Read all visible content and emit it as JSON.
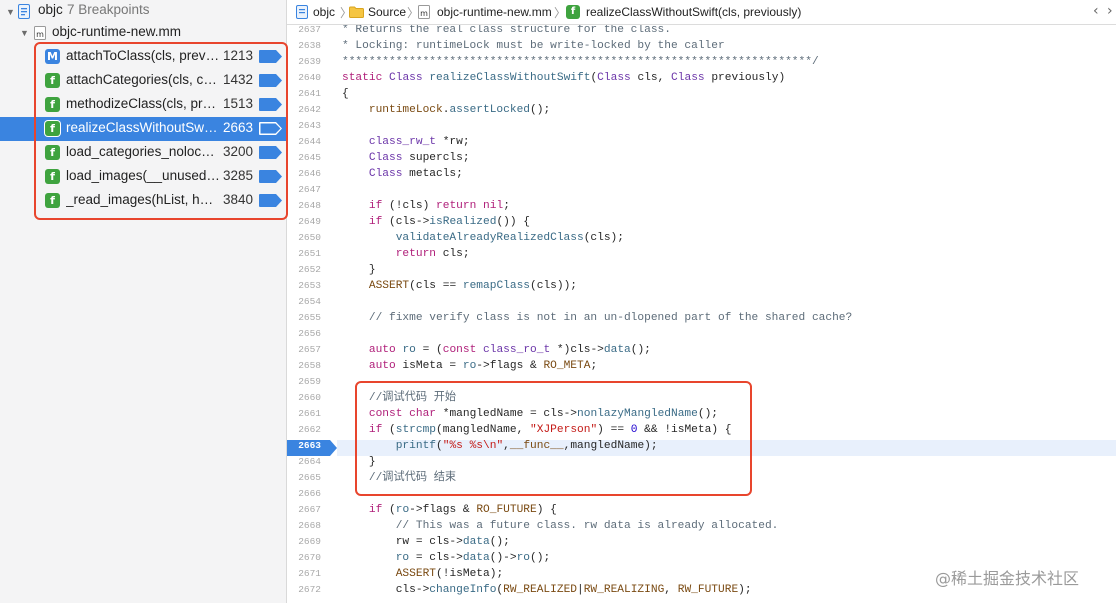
{
  "sidebar": {
    "root": {
      "title": "objc",
      "subtitle": "7 Breakpoints"
    },
    "file": {
      "name": "objc-runtime-new.mm"
    },
    "breakpoints": [
      {
        "icon": "M",
        "icon_color": "#3a84e0",
        "name": "attachToClass(cls, previously, flags)",
        "line": "1213",
        "selected": false
      },
      {
        "icon": "f",
        "icon_color": "#3fa33f",
        "name": "attachCategories(cls, cats_list, cats_count, flags)",
        "line": "1432",
        "selected": false
      },
      {
        "icon": "f",
        "icon_color": "#3fa33f",
        "name": "methodizeClass(cls, previously)",
        "line": "1513",
        "selected": false
      },
      {
        "icon": "f",
        "icon_color": "#3fa33f",
        "name": "realizeClassWithoutSwift(cls, previously)",
        "line": "2663",
        "selected": true
      },
      {
        "icon": "f",
        "icon_color": "#3fa33f",
        "name": "load_categories_nolock(hi)",
        "line": "3200",
        "selected": false
      },
      {
        "icon": "f",
        "icon_color": "#3fa33f",
        "name": "load_images(__unused, mh)",
        "line": "3285",
        "selected": false
      },
      {
        "icon": "f",
        "icon_color": "#3fa33f",
        "name": "_read_images(hList, hCount, totalClasses)",
        "line": "3840",
        "selected": false
      }
    ]
  },
  "jumpbar": {
    "items": [
      "objc",
      "Source",
      "objc-runtime-new.mm",
      "realizeClassWithoutSwift(cls, previously)"
    ]
  },
  "editor": {
    "current_line": "2663",
    "lines": [
      {
        "n": "2637",
        "t": "* Returns the real class structure for the class."
      },
      {
        "n": "2638",
        "t": "* Locking: runtimeLock must be write-locked by the caller"
      },
      {
        "n": "2639",
        "t": "**********************************************************************/"
      },
      {
        "n": "2640",
        "t": "static Class realizeClassWithoutSwift(Class cls, Class previously)"
      },
      {
        "n": "2641",
        "t": "{"
      },
      {
        "n": "2642",
        "t": "    runtimeLock.assertLocked();"
      },
      {
        "n": "2643",
        "t": ""
      },
      {
        "n": "2644",
        "t": "    class_rw_t *rw;"
      },
      {
        "n": "2645",
        "t": "    Class supercls;"
      },
      {
        "n": "2646",
        "t": "    Class metacls;"
      },
      {
        "n": "2647",
        "t": ""
      },
      {
        "n": "2648",
        "t": "    if (!cls) return nil;"
      },
      {
        "n": "2649",
        "t": "    if (cls->isRealized()) {"
      },
      {
        "n": "2650",
        "t": "        validateAlreadyRealizedClass(cls);"
      },
      {
        "n": "2651",
        "t": "        return cls;"
      },
      {
        "n": "2652",
        "t": "    }"
      },
      {
        "n": "2653",
        "t": "    ASSERT(cls == remapClass(cls));"
      },
      {
        "n": "2654",
        "t": ""
      },
      {
        "n": "2655",
        "t": "    // fixme verify class is not in an un-dlopened part of the shared cache?"
      },
      {
        "n": "2656",
        "t": ""
      },
      {
        "n": "2657",
        "t": "    auto ro = (const class_ro_t *)cls->data();"
      },
      {
        "n": "2658",
        "t": "    auto isMeta = ro->flags & RO_META;"
      },
      {
        "n": "2659",
        "t": ""
      },
      {
        "n": "2660",
        "t": "    //调试代码 开始"
      },
      {
        "n": "2661",
        "t": "    const char *mangledName = cls->nonlazyMangledName();"
      },
      {
        "n": "2662",
        "t": "    if (strcmp(mangledName, \"XJPerson\") == 0 && !isMeta) {"
      },
      {
        "n": "2663",
        "t": "        printf(\"%s %s\\n\",__func__,mangledName);"
      },
      {
        "n": "2664",
        "t": "    }"
      },
      {
        "n": "2665",
        "t": "    //调试代码 结束"
      },
      {
        "n": "2666",
        "t": ""
      },
      {
        "n": "2667",
        "t": "    if (ro->flags & RO_FUTURE) {"
      },
      {
        "n": "2668",
        "t": "        // This was a future class. rw data is already allocated."
      },
      {
        "n": "2669",
        "t": "        rw = cls->data();"
      },
      {
        "n": "2670",
        "t": "        ro = cls->data()->ro();"
      },
      {
        "n": "2671",
        "t": "        ASSERT(!isMeta);"
      },
      {
        "n": "2672",
        "t": "        cls->changeInfo(RW_REALIZED|RW_REALIZING, RW_FUTURE);"
      }
    ]
  },
  "watermark": "@稀土掘金技术社区"
}
